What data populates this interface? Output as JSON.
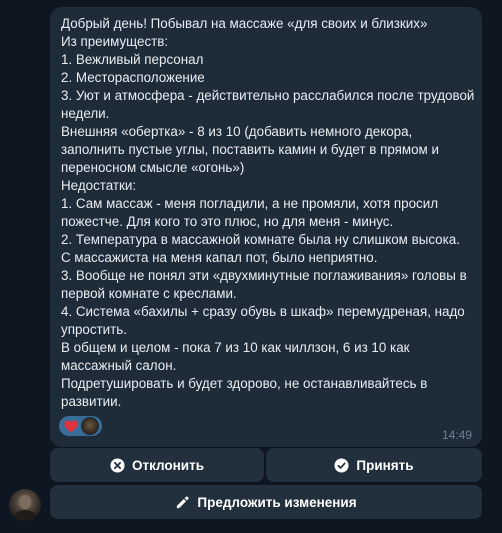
{
  "message": {
    "lines": [
      "Добрый день! Побывал на массаже «для своих и близких»",
      "Из преимуществ:",
      "1. Вежливый персонал",
      "2. Месторасположение",
      "3. Уют и атмосфера - действительно расслабился после трудовой",
      "недели.",
      "Внешняя «обертка» - 8 из 10 (добавить немного декора,",
      "заполнить пустые углы, поставить камин и будет в прямом и",
      "переносном смысле «огонь»)",
      "Недостатки:",
      "1. Сам массаж - меня погладили, а не промяли, хотя просил",
      "пожестче. Для кого то это плюс, но для меня - минус.",
      "2. Температура в массажной комнате была ну слишком высока.",
      "С массажиста на меня капал пот, было неприятно.",
      "3. Вообще не понял эти «двухминутные поглаживания» головы в",
      "первой комнате с креслами.",
      "4. Система «бахилы + сразу обувь в шкаф» перемудреная, надо",
      "упростить.",
      "В общем и целом - пока 7 из 10 как чиллзон, 6 из 10 как",
      "массажный салон.",
      "Подретушировать и будет здорово, не останавливайтесь в",
      "развитии."
    ],
    "time": "14:49",
    "reaction": {
      "emoji_icon": "heart-icon",
      "color": "#e0343d"
    }
  },
  "keyboard": {
    "decline_label": "Отклонить",
    "accept_label": "Принять",
    "suggest_label": "Предложить изменения"
  },
  "colors": {
    "background": "#0e1621",
    "bubble": "#1e2c3a",
    "button": "#22303d",
    "reaction_pill": "#3a6d97",
    "time": "#6d7f8f"
  }
}
